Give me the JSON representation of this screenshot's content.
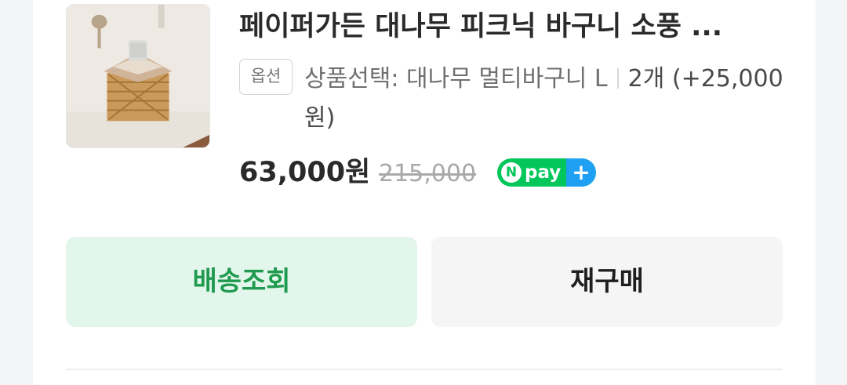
{
  "product": {
    "title": "페이퍼가든 대나무 피크닉 바구니 소풍 ...",
    "option_badge": "옵션",
    "option_label": "상품선택: 대나무 멀티바구니 L",
    "option_qty": "2개 (+25,000원)",
    "price": "63,000원",
    "original_price": "215,000",
    "pay_badge": {
      "letter": "N",
      "word": "pay",
      "plus": "+"
    }
  },
  "actions": {
    "track_label": "배송조회",
    "rebuy_label": "재구매"
  },
  "colors": {
    "accent_green": "#1f9a4e",
    "track_bg": "#e3f6ec",
    "npay_green": "#03c75a",
    "npay_blue": "#1fa0f2"
  },
  "icons": {
    "thumbnail": "bamboo-basket-photo"
  }
}
